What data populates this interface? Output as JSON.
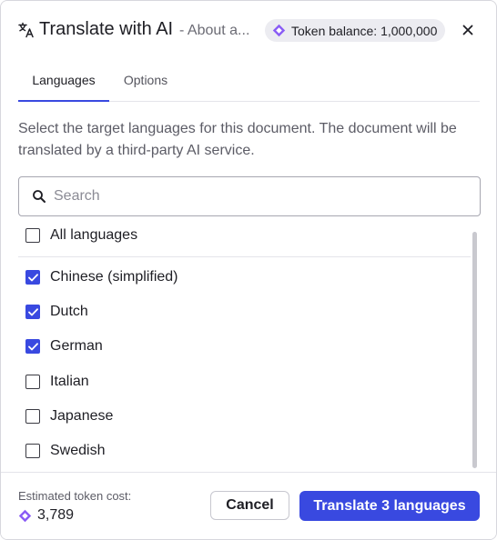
{
  "header": {
    "title": "Translate with AI",
    "subtitle": "- About a...",
    "token_badge": "Token balance: 1,000,000",
    "icon": "translate-icon",
    "close_icon": "close-icon"
  },
  "tabs": [
    {
      "label": "Languages",
      "active": true
    },
    {
      "label": "Options",
      "active": false
    }
  ],
  "description": "Select the target languages for this document. The document will be translated by a third-party AI service.",
  "search": {
    "placeholder": "Search",
    "value": ""
  },
  "languages": {
    "all": {
      "label": "All languages",
      "checked": false
    },
    "items": [
      {
        "label": "Chinese (simplified)",
        "checked": true
      },
      {
        "label": "Dutch",
        "checked": true
      },
      {
        "label": "German",
        "checked": true
      },
      {
        "label": "Italian",
        "checked": false
      },
      {
        "label": "Japanese",
        "checked": false
      },
      {
        "label": "Swedish",
        "checked": false
      }
    ]
  },
  "footer": {
    "cost_label": "Estimated token cost:",
    "cost_value": "3,789",
    "cancel_label": "Cancel",
    "translate_label": "Translate 3 languages"
  },
  "colors": {
    "accent": "#3949e0",
    "token_icon": "#8a5cf5"
  }
}
